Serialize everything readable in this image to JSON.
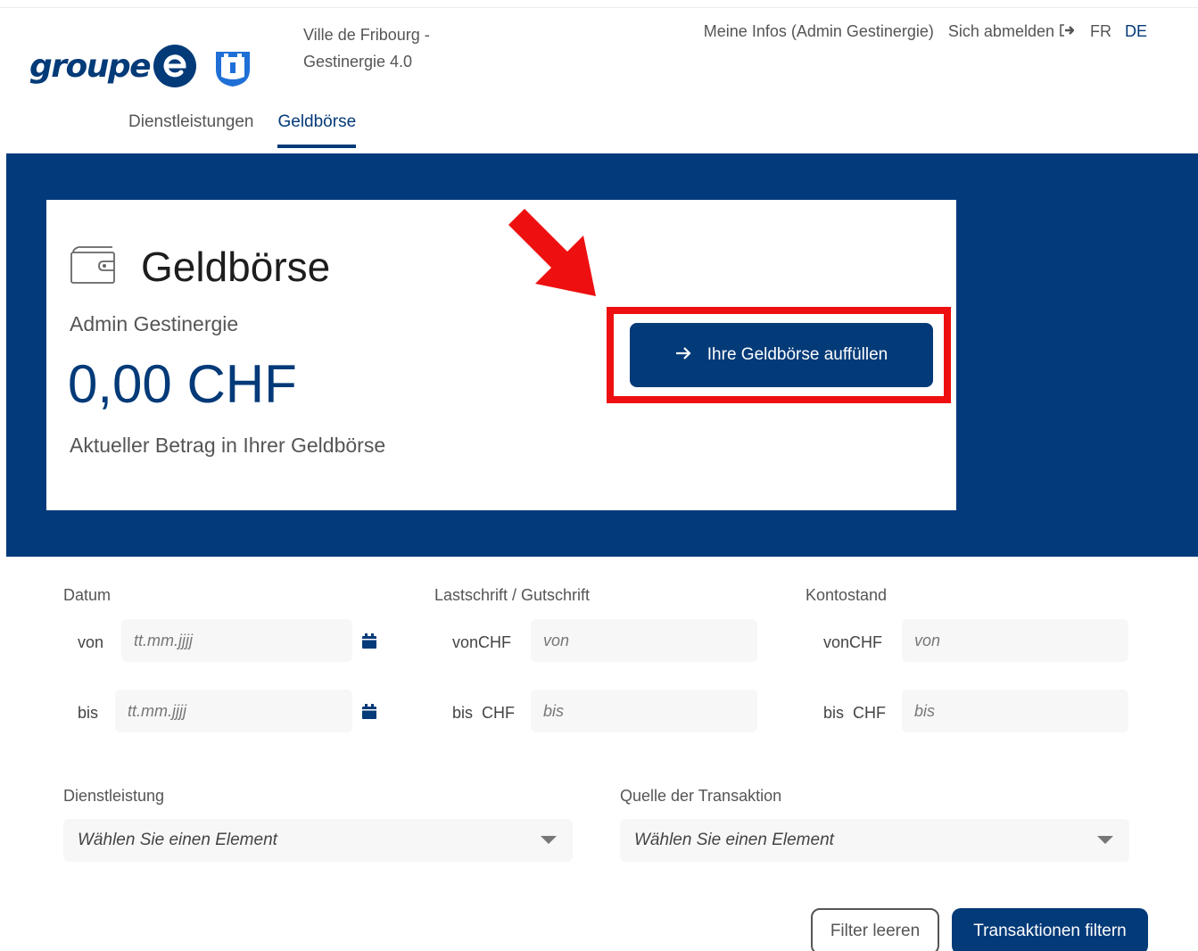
{
  "header": {
    "logo_text": "groupe",
    "site_title_line1": "Ville de Fribourg -",
    "site_title_line2": "Gestinergie 4.0",
    "my_info": "Meine Infos (Admin Gestinergie)",
    "logout": "Sich abmelden",
    "lang_fr": "FR",
    "lang_de": "DE"
  },
  "tabs": [
    {
      "label": "Dienstleistungen",
      "active": false
    },
    {
      "label": "Geldbörse",
      "active": true
    }
  ],
  "wallet": {
    "title": "Geldbörse",
    "user": "Admin Gestinergie",
    "amount": "0,00 CHF",
    "subtitle": "Aktueller Betrag in Ihrer Geldbörse",
    "topup_button": "Ihre Geldbörse auffüllen"
  },
  "filters": {
    "date": {
      "label": "Datum",
      "from_label": "von",
      "to_label": "bis",
      "from_placeholder": "tt.mm.jjjj",
      "to_placeholder": "tt.mm.jjjj"
    },
    "debit_credit": {
      "label": "Lastschrift / Gutschrift",
      "from_label": "vonCHF",
      "to_label": "bis  CHF",
      "from_placeholder": "von",
      "to_placeholder": "bis"
    },
    "balance": {
      "label": "Kontostand",
      "from_label": "vonCHF",
      "to_label": "bis  CHF",
      "from_placeholder": "von",
      "to_placeholder": "bis"
    },
    "service": {
      "label": "Dienstleistung",
      "placeholder": "Wählen Sie einen Element"
    },
    "source": {
      "label": "Quelle der Transaktion",
      "placeholder": "Wählen Sie einen Element"
    },
    "clear_button": "Filter leeren",
    "filter_button": "Transaktionen filtern"
  },
  "colors": {
    "brand_blue": "#033a78",
    "highlight_red": "#ee1010"
  }
}
